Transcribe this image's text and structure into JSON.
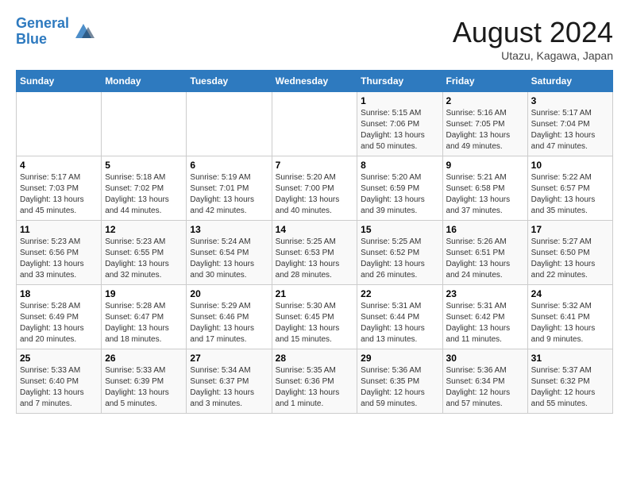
{
  "header": {
    "logo_line1": "General",
    "logo_line2": "Blue",
    "month_year": "August 2024",
    "location": "Utazu, Kagawa, Japan"
  },
  "weekdays": [
    "Sunday",
    "Monday",
    "Tuesday",
    "Wednesday",
    "Thursday",
    "Friday",
    "Saturday"
  ],
  "weeks": [
    [
      {
        "day": "",
        "info": ""
      },
      {
        "day": "",
        "info": ""
      },
      {
        "day": "",
        "info": ""
      },
      {
        "day": "",
        "info": ""
      },
      {
        "day": "1",
        "info": "Sunrise: 5:15 AM\nSunset: 7:06 PM\nDaylight: 13 hours\nand 50 minutes."
      },
      {
        "day": "2",
        "info": "Sunrise: 5:16 AM\nSunset: 7:05 PM\nDaylight: 13 hours\nand 49 minutes."
      },
      {
        "day": "3",
        "info": "Sunrise: 5:17 AM\nSunset: 7:04 PM\nDaylight: 13 hours\nand 47 minutes."
      }
    ],
    [
      {
        "day": "4",
        "info": "Sunrise: 5:17 AM\nSunset: 7:03 PM\nDaylight: 13 hours\nand 45 minutes."
      },
      {
        "day": "5",
        "info": "Sunrise: 5:18 AM\nSunset: 7:02 PM\nDaylight: 13 hours\nand 44 minutes."
      },
      {
        "day": "6",
        "info": "Sunrise: 5:19 AM\nSunset: 7:01 PM\nDaylight: 13 hours\nand 42 minutes."
      },
      {
        "day": "7",
        "info": "Sunrise: 5:20 AM\nSunset: 7:00 PM\nDaylight: 13 hours\nand 40 minutes."
      },
      {
        "day": "8",
        "info": "Sunrise: 5:20 AM\nSunset: 6:59 PM\nDaylight: 13 hours\nand 39 minutes."
      },
      {
        "day": "9",
        "info": "Sunrise: 5:21 AM\nSunset: 6:58 PM\nDaylight: 13 hours\nand 37 minutes."
      },
      {
        "day": "10",
        "info": "Sunrise: 5:22 AM\nSunset: 6:57 PM\nDaylight: 13 hours\nand 35 minutes."
      }
    ],
    [
      {
        "day": "11",
        "info": "Sunrise: 5:23 AM\nSunset: 6:56 PM\nDaylight: 13 hours\nand 33 minutes."
      },
      {
        "day": "12",
        "info": "Sunrise: 5:23 AM\nSunset: 6:55 PM\nDaylight: 13 hours\nand 32 minutes."
      },
      {
        "day": "13",
        "info": "Sunrise: 5:24 AM\nSunset: 6:54 PM\nDaylight: 13 hours\nand 30 minutes."
      },
      {
        "day": "14",
        "info": "Sunrise: 5:25 AM\nSunset: 6:53 PM\nDaylight: 13 hours\nand 28 minutes."
      },
      {
        "day": "15",
        "info": "Sunrise: 5:25 AM\nSunset: 6:52 PM\nDaylight: 13 hours\nand 26 minutes."
      },
      {
        "day": "16",
        "info": "Sunrise: 5:26 AM\nSunset: 6:51 PM\nDaylight: 13 hours\nand 24 minutes."
      },
      {
        "day": "17",
        "info": "Sunrise: 5:27 AM\nSunset: 6:50 PM\nDaylight: 13 hours\nand 22 minutes."
      }
    ],
    [
      {
        "day": "18",
        "info": "Sunrise: 5:28 AM\nSunset: 6:49 PM\nDaylight: 13 hours\nand 20 minutes."
      },
      {
        "day": "19",
        "info": "Sunrise: 5:28 AM\nSunset: 6:47 PM\nDaylight: 13 hours\nand 18 minutes."
      },
      {
        "day": "20",
        "info": "Sunrise: 5:29 AM\nSunset: 6:46 PM\nDaylight: 13 hours\nand 17 minutes."
      },
      {
        "day": "21",
        "info": "Sunrise: 5:30 AM\nSunset: 6:45 PM\nDaylight: 13 hours\nand 15 minutes."
      },
      {
        "day": "22",
        "info": "Sunrise: 5:31 AM\nSunset: 6:44 PM\nDaylight: 13 hours\nand 13 minutes."
      },
      {
        "day": "23",
        "info": "Sunrise: 5:31 AM\nSunset: 6:42 PM\nDaylight: 13 hours\nand 11 minutes."
      },
      {
        "day": "24",
        "info": "Sunrise: 5:32 AM\nSunset: 6:41 PM\nDaylight: 13 hours\nand 9 minutes."
      }
    ],
    [
      {
        "day": "25",
        "info": "Sunrise: 5:33 AM\nSunset: 6:40 PM\nDaylight: 13 hours\nand 7 minutes."
      },
      {
        "day": "26",
        "info": "Sunrise: 5:33 AM\nSunset: 6:39 PM\nDaylight: 13 hours\nand 5 minutes."
      },
      {
        "day": "27",
        "info": "Sunrise: 5:34 AM\nSunset: 6:37 PM\nDaylight: 13 hours\nand 3 minutes."
      },
      {
        "day": "28",
        "info": "Sunrise: 5:35 AM\nSunset: 6:36 PM\nDaylight: 13 hours\nand 1 minute."
      },
      {
        "day": "29",
        "info": "Sunrise: 5:36 AM\nSunset: 6:35 PM\nDaylight: 12 hours\nand 59 minutes."
      },
      {
        "day": "30",
        "info": "Sunrise: 5:36 AM\nSunset: 6:34 PM\nDaylight: 12 hours\nand 57 minutes."
      },
      {
        "day": "31",
        "info": "Sunrise: 5:37 AM\nSunset: 6:32 PM\nDaylight: 12 hours\nand 55 minutes."
      }
    ]
  ]
}
